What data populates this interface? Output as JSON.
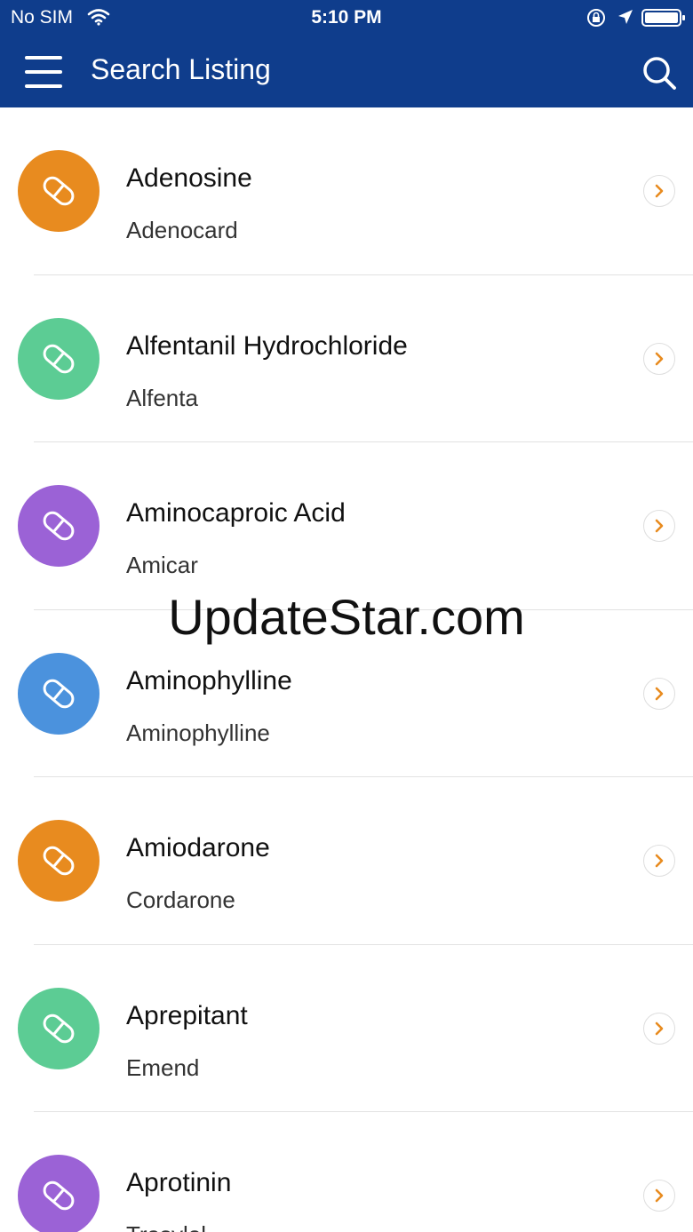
{
  "status_bar": {
    "carrier": "No SIM",
    "time": "5:10 PM"
  },
  "nav": {
    "title": "Search Listing",
    "menu_icon": "hamburger-menu-icon",
    "search_icon": "search-icon"
  },
  "colors": {
    "nav_background": "#0f3d8c",
    "orange": "#e88b1f",
    "green": "#5ccc94",
    "purple": "#9b62d6",
    "blue": "#4b92dd",
    "chevron": "#e88b1f"
  },
  "drugs": [
    {
      "name": "Adenosine",
      "brand": "Adenocard",
      "color": "#e88b1f",
      "icon": "pill-icon"
    },
    {
      "name": "Alfentanil Hydrochloride",
      "brand": "Alfenta",
      "color": "#5ccc94",
      "icon": "pill-icon"
    },
    {
      "name": "Aminocaproic Acid",
      "brand": "Amicar",
      "color": "#9b62d6",
      "icon": "pill-icon"
    },
    {
      "name": "Aminophylline",
      "brand": "Aminophylline",
      "color": "#4b92dd",
      "icon": "pill-icon"
    },
    {
      "name": "Amiodarone",
      "brand": "Cordarone",
      "color": "#e88b1f",
      "icon": "pill-icon"
    },
    {
      "name": "Aprepitant",
      "brand": "Emend",
      "color": "#5ccc94",
      "icon": "pill-icon"
    },
    {
      "name": "Aprotinin",
      "brand": "Trasylol",
      "color": "#9b62d6",
      "icon": "pill-icon"
    }
  ],
  "watermark": "UpdateStar.com"
}
